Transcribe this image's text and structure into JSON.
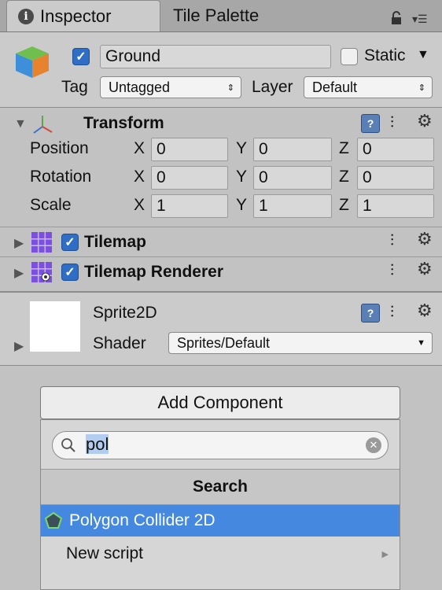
{
  "tabs": {
    "inspector": "Inspector",
    "tile_palette": "Tile Palette"
  },
  "object": {
    "name": "Ground",
    "active": true,
    "static_label": "Static",
    "static": false,
    "tag_label": "Tag",
    "tag_value": "Untagged",
    "layer_label": "Layer",
    "layer_value": "Default"
  },
  "transform": {
    "title": "Transform",
    "rows": [
      {
        "label": "Position",
        "x": "0",
        "y": "0",
        "z": "0"
      },
      {
        "label": "Rotation",
        "x": "0",
        "y": "0",
        "z": "0"
      },
      {
        "label": "Scale",
        "x": "1",
        "y": "1",
        "z": "1"
      }
    ],
    "axis": {
      "x": "X",
      "y": "Y",
      "z": "Z"
    }
  },
  "tilemap": {
    "title": "Tilemap",
    "enabled": true
  },
  "tilemap_renderer": {
    "title": "Tilemap Renderer",
    "enabled": true
  },
  "material": {
    "name": "Sprite2D",
    "shader_label": "Shader",
    "shader_value": "Sprites/Default"
  },
  "add_component": {
    "label": "Add Component",
    "search_value": "pol",
    "section": "Search",
    "results": [
      {
        "label": "Polygon Collider 2D",
        "selected": true
      },
      {
        "label": "New script",
        "selected": false
      }
    ]
  },
  "colors": {
    "selection": "#4488e0",
    "checkbox": "#2f6ec4",
    "panel": "#c2c2c2"
  }
}
